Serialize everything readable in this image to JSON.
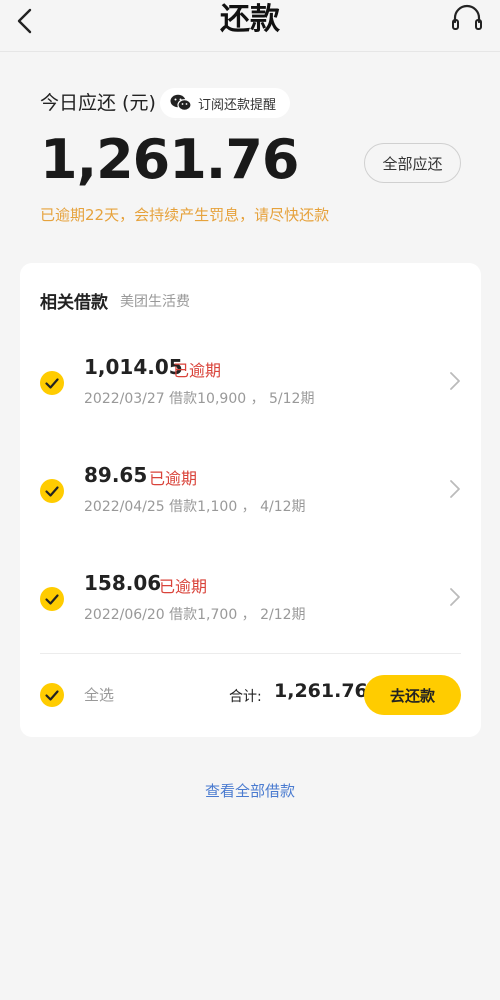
{
  "header": {
    "title": "还款"
  },
  "summary": {
    "label": "今日应还 (元)",
    "subscribe_label": "订阅还款提醒",
    "amount": "1,261.76",
    "all_due_label": "全部应还",
    "warning": "已逾期22天，会持续产生罚息，请尽快还款"
  },
  "card": {
    "title": "相关借款",
    "subtitle": "美团生活费",
    "loans": [
      {
        "amount": "1,014.05",
        "status": "已逾期",
        "detail": "2022/03/27 借款10,900 ， 5/12期"
      },
      {
        "amount": "89.65",
        "status": "已逾期",
        "detail": "2022/04/25 借款1,100 ， 4/12期"
      },
      {
        "amount": "158.06",
        "status": "已逾期",
        "detail": "2022/06/20 借款1,700 ， 2/12期"
      }
    ],
    "select_all_label": "全选",
    "total_label": "合计:",
    "total_value": "1,261.76",
    "repay_button": "去还款"
  },
  "footer": {
    "view_all": "查看全部借款"
  },
  "colors": {
    "accent": "#ffcc00",
    "overdue": "#d9433a",
    "warning": "#e6a23c",
    "link": "#4a7bd0"
  },
  "icons": {
    "back": "back-arrow-icon",
    "support": "headset-icon",
    "wechat": "wechat-icon",
    "check": "check-circle-icon",
    "chevron": "chevron-right-icon"
  }
}
